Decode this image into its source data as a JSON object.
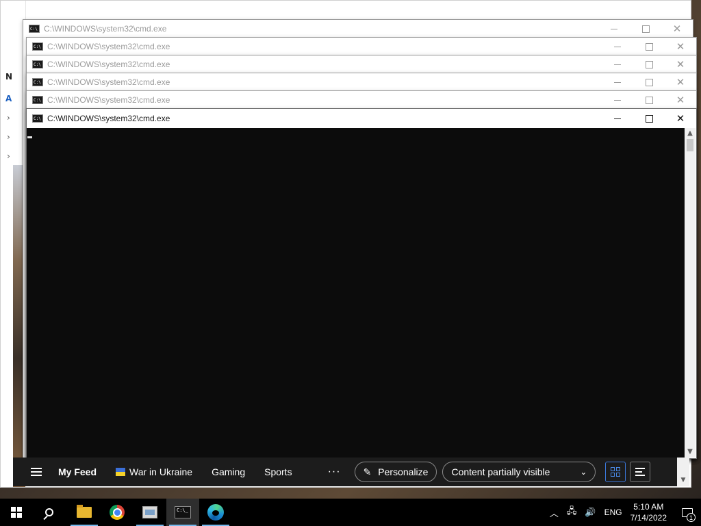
{
  "cmd_windows": [
    {
      "title": "C:\\WINDOWS\\system32\\cmd.exe",
      "active": false
    },
    {
      "title": "C:\\WINDOWS\\system32\\cmd.exe",
      "active": false
    },
    {
      "title": "C:\\WINDOWS\\system32\\cmd.exe",
      "active": false
    },
    {
      "title": "C:\\WINDOWS\\system32\\cmd.exe",
      "active": false
    },
    {
      "title": "C:\\WINDOWS\\system32\\cmd.exe",
      "active": false
    },
    {
      "title": "C:\\WINDOWS\\system32\\cmd.exe",
      "active": true
    }
  ],
  "window_controls": {
    "minimize": "minimize-icon",
    "maximize": "maximize-icon",
    "close": "close-icon"
  },
  "background_app": {
    "side_letters": [
      "N",
      "A"
    ]
  },
  "feed": {
    "my_feed": "My Feed",
    "war_in_ukraine": "War in Ukraine",
    "gaming": "Gaming",
    "sports": "Sports",
    "more": "···",
    "personalize": "Personalize",
    "content_visibility": "Content partially visible"
  },
  "taskbar": {
    "apps": [
      "start",
      "search",
      "file-explorer",
      "chrome",
      "task-manager",
      "command-prompt",
      "edge"
    ],
    "language": "ENG",
    "time": "5:10 AM",
    "date": "7/14/2022",
    "notification_count": "1"
  },
  "colors": {
    "console_bg": "#0c0c0c",
    "accent": "#76b9ed",
    "feed_bg": "#1c1c1c"
  }
}
